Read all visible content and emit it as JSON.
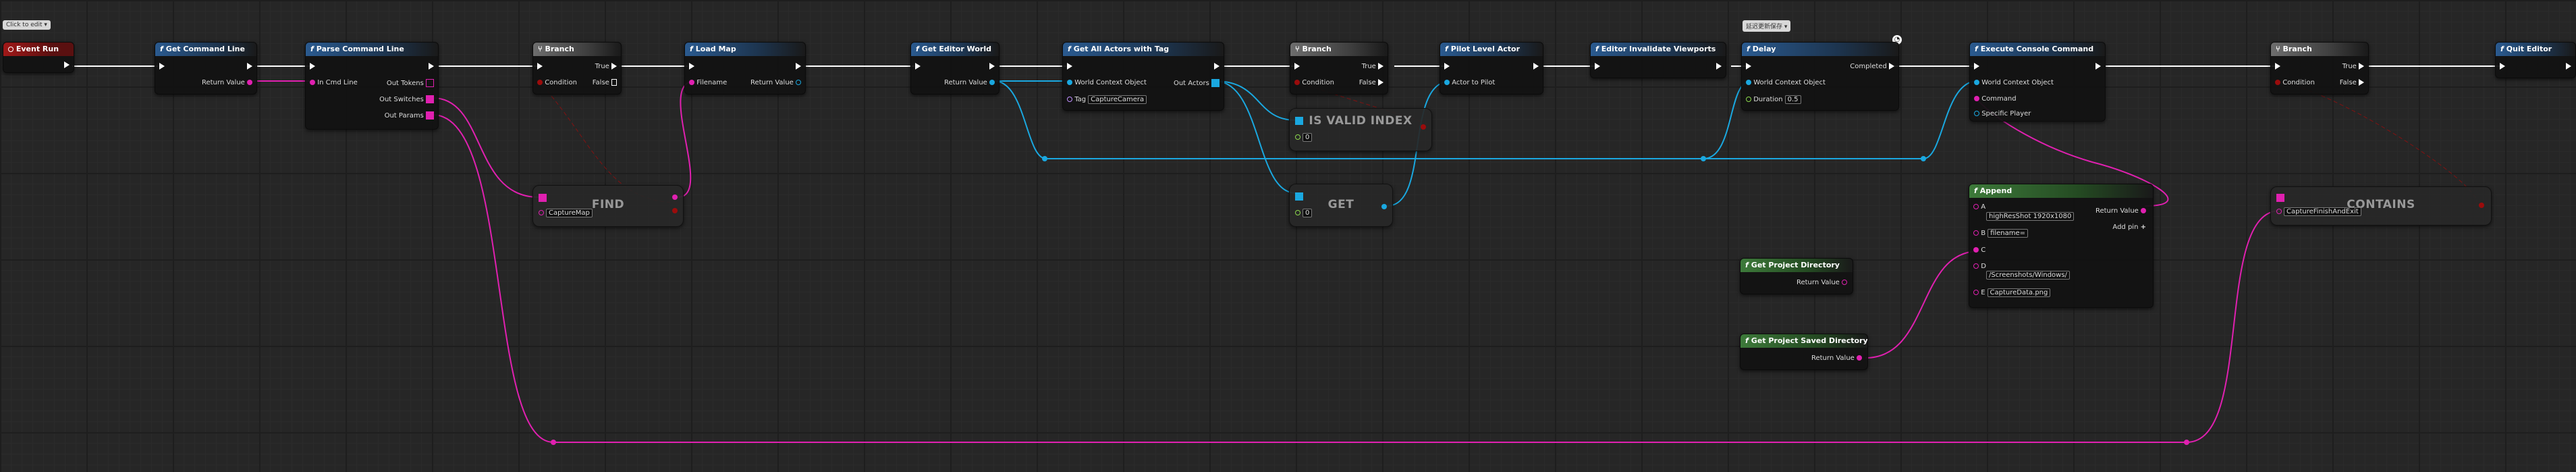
{
  "graph": {
    "comment_bubble": "Click to edit",
    "delay_comment": "延迟更新保存",
    "clock_glyph": "◔"
  },
  "nodes": {
    "event_run": {
      "title": "Event Run"
    },
    "get_command_line": {
      "title": "Get Command Line",
      "out": "Return Value"
    },
    "parse_command_line": {
      "title": "Parse Command Line",
      "in": "In Cmd Line",
      "out_tokens": "Out Tokens",
      "out_switches": "Out Switches",
      "out_params": "Out Params"
    },
    "branch1": {
      "title": "Branch",
      "cond": "Condition",
      "true": "True",
      "false": "False"
    },
    "load_map": {
      "title": "Load Map",
      "in": "Filename",
      "out": "Return Value"
    },
    "find": {
      "title": "FIND",
      "value": "CaptureMap"
    },
    "get_editor_world": {
      "title": "Get Editor World",
      "out": "Return Value"
    },
    "get_all_actors": {
      "title": "Get All Actors with Tag",
      "wco": "World Context Object",
      "tag": "Tag",
      "tag_value": "CaptureCamera",
      "out": "Out Actors"
    },
    "is_valid_index": {
      "title": "IS VALID INDEX",
      "value": "0"
    },
    "get": {
      "title": "GET",
      "value": "0"
    },
    "branch2": {
      "title": "Branch",
      "cond": "Condition",
      "true": "True",
      "false": "False"
    },
    "pilot_level_actor": {
      "title": "Pilot Level Actor",
      "in": "Actor to Pilot"
    },
    "editor_invalidate": {
      "title": "Editor Invalidate Viewports"
    },
    "delay": {
      "title": "Delay",
      "wco": "World Context Object",
      "completed": "Completed",
      "duration": "Duration",
      "duration_value": "0.5"
    },
    "execute_console": {
      "title": "Execute Console Command",
      "wco": "World Context Object",
      "command": "Command",
      "player": "Specific Player"
    },
    "append": {
      "title": "Append",
      "a": "A",
      "a_value": "highResShot 1920x1080",
      "b": "B",
      "b_value": "filename=",
      "c": "C",
      "d": "D",
      "d_value": "/Screenshots/Windows/",
      "e": "E",
      "e_value": "CaptureData.png",
      "out": "Return Value",
      "add_pin": "Add pin"
    },
    "get_project_dir": {
      "title": "Get Project Directory",
      "out": "Return Value"
    },
    "get_project_saved_dir": {
      "title": "Get Project Saved Directory",
      "out": "Return Value"
    },
    "branch3": {
      "title": "Branch",
      "cond": "Condition",
      "true": "True",
      "false": "False"
    },
    "contains": {
      "title": "CONTAINS",
      "value": "CaptureFinishAndExit"
    },
    "quit_editor": {
      "title": "Quit Editor"
    }
  },
  "colors": {
    "exec": "#ffffff",
    "string": "#e020b0",
    "object": "#1aa8e0",
    "bool": "#9a0c0c",
    "float": "#8cd84c",
    "name": "#c090ff",
    "struct": "#e0a020"
  },
  "icons": {
    "function": "f",
    "exec": "exec-arrow"
  }
}
